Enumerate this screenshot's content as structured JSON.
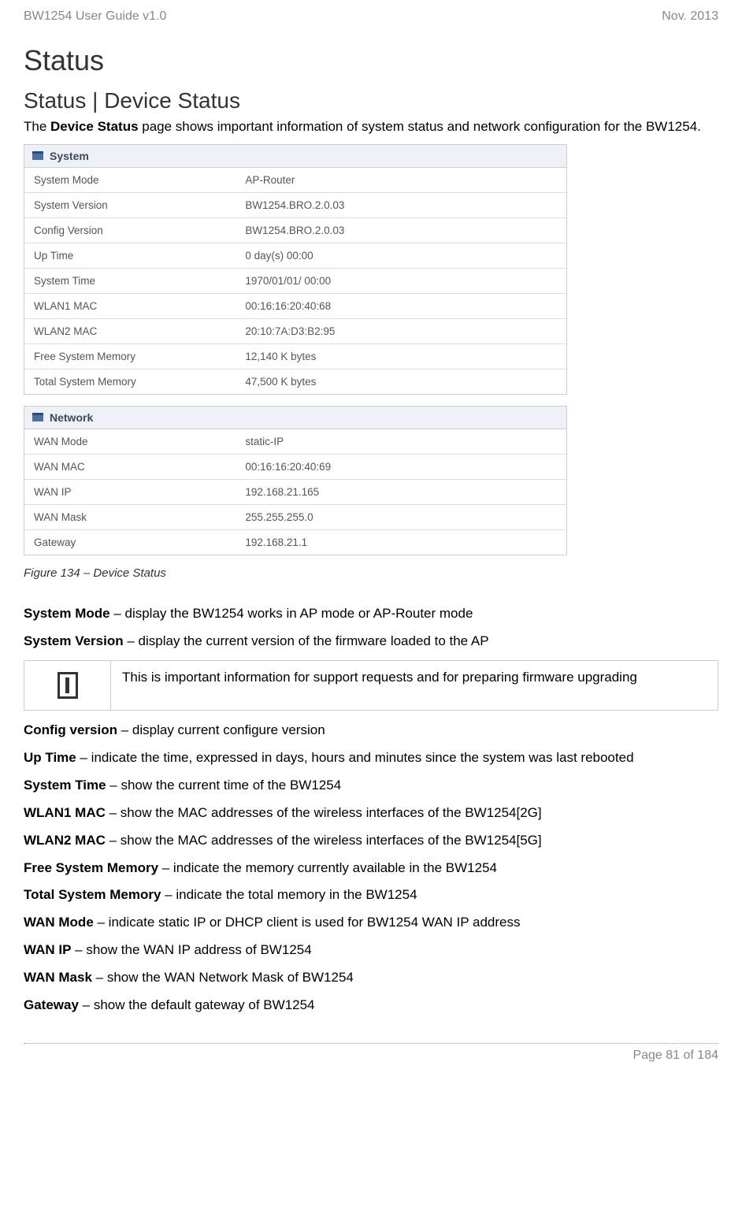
{
  "header": {
    "left": "BW1254 User Guide v1.0",
    "right": "Nov.  2013"
  },
  "title_h1": "Status",
  "title_h2": "Status | Device Status",
  "intro_pre": "The ",
  "intro_bold": "Device Status",
  "intro_post": " page shows important information of system status and network configuration for the BW1254.",
  "system_table": {
    "heading": "System",
    "rows": [
      {
        "label": "System Mode",
        "value": "AP-Router"
      },
      {
        "label": "System Version",
        "value": "BW1254.BRO.2.0.03"
      },
      {
        "label": "Config Version",
        "value": "BW1254.BRO.2.0.03"
      },
      {
        "label": "Up Time",
        "value": "0 day(s) 00:00"
      },
      {
        "label": "System Time",
        "value": "1970/01/01/ 00:00"
      },
      {
        "label": "WLAN1 MAC",
        "value": "00:16:16:20:40:68"
      },
      {
        "label": "WLAN2 MAC",
        "value": "20:10:7A:D3:B2:95"
      },
      {
        "label": "Free System Memory",
        "value": "12,140 K bytes"
      },
      {
        "label": "Total System Memory",
        "value": "47,500 K bytes"
      }
    ]
  },
  "network_table": {
    "heading": "Network",
    "rows": [
      {
        "label": "WAN Mode",
        "value": "static-IP"
      },
      {
        "label": "WAN MAC",
        "value": "00:16:16:20:40:69"
      },
      {
        "label": "WAN IP",
        "value": "192.168.21.165"
      },
      {
        "label": "WAN Mask",
        "value": "255.255.255.0"
      },
      {
        "label": "Gateway",
        "value": "192.168.21.1"
      }
    ]
  },
  "figure_caption": "Figure 134  – Device Status",
  "defs": [
    {
      "term": "System Mode",
      "desc": " – display the BW1254 works in AP mode or AP-Router mode"
    },
    {
      "term": "System Version",
      "desc": " – display the current version of the firmware loaded to the AP"
    }
  ],
  "info_note": "This is important information for support requests and for preparing firmware upgrading",
  "defs2": [
    {
      "term": "Config version",
      "desc": " – display current configure version"
    },
    {
      "term": "Up Time",
      "desc": " – indicate the time, expressed in days, hours and minutes since the system was last rebooted"
    },
    {
      "term": "System Time",
      "desc": " – show the current time of the BW1254"
    },
    {
      "term": "WLAN1 MAC",
      "desc": " – show the MAC addresses of the wireless interfaces of the BW1254[2G]"
    },
    {
      "term": "WLAN2 MAC",
      "desc": " – show the MAC addresses of the wireless interfaces of the BW1254[5G]"
    },
    {
      "term": "Free System Memory",
      "desc": " – indicate the memory currently available in the BW1254"
    },
    {
      "term": "Total System Memory",
      "desc": " – indicate the total memory in the BW1254"
    },
    {
      "term": "WAN Mode",
      "desc": " – indicate static IP or DHCP client is used for BW1254 WAN IP address"
    },
    {
      "term": "WAN IP",
      "desc": " – show the WAN IP address of BW1254"
    },
    {
      "term": "WAN Mask",
      "desc": " – show the WAN Network Mask of BW1254"
    },
    {
      "term": "Gateway",
      "desc": " – show the default gateway of BW1254"
    }
  ],
  "footer": "Page 81 of 184"
}
